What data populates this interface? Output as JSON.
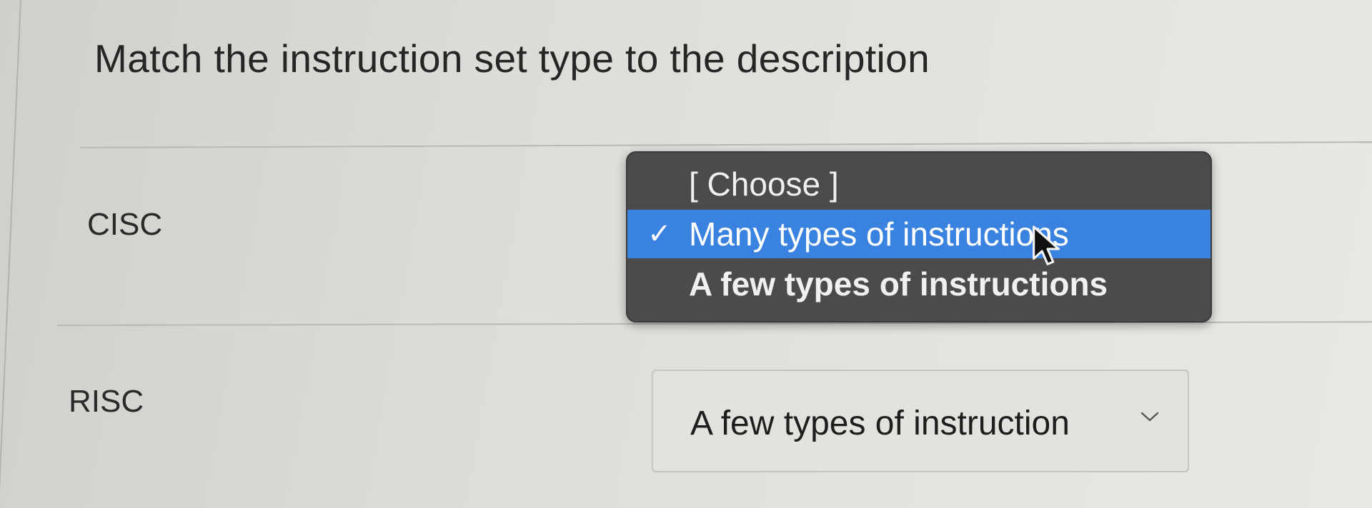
{
  "question": {
    "title": "Match the instruction set type to the description"
  },
  "rows": [
    {
      "term": "CISC",
      "dropdown": {
        "state": "open",
        "options": [
          {
            "label": "[ Choose ]",
            "highlighted": false,
            "checked": false
          },
          {
            "label": "Many types of instructions",
            "highlighted": true,
            "checked": true
          },
          {
            "label": "A few types of instructions",
            "highlighted": false,
            "checked": false
          }
        ],
        "checkmark": "✓"
      }
    },
    {
      "term": "RISC",
      "select": {
        "state": "closed",
        "value": "A few types of instruction",
        "icon": "chevron-down-icon"
      }
    }
  ],
  "colors": {
    "menu_background": "#4b4b4b",
    "highlight": "#3a82e0",
    "page_background": "#dcdcd8"
  }
}
